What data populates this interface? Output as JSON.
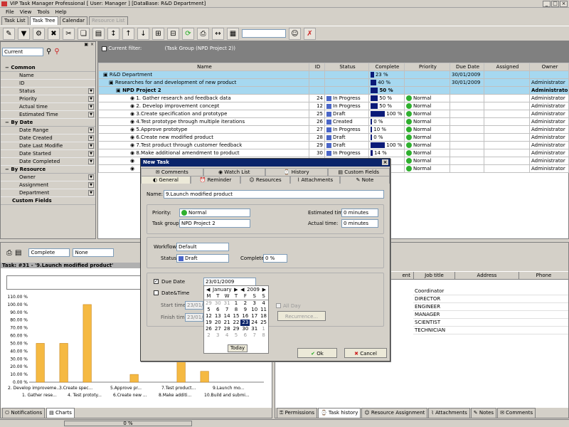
{
  "app": {
    "title": "VIP Task Manager Professional [ User: Manager ] [DataBase: R&D Department]"
  },
  "menu": [
    "File",
    "View",
    "Tools",
    "Help"
  ],
  "top_tabs": [
    {
      "label": "Task List"
    },
    {
      "label": "Task Tree"
    },
    {
      "label": "Calendar"
    },
    {
      "label": "Resource List"
    }
  ],
  "left_panel": {
    "view_select": "Current",
    "groups": [
      {
        "label": "Common",
        "items": [
          "Name",
          "ID",
          "Status",
          "Priority",
          "Actual time",
          "Estimated Time"
        ]
      },
      {
        "label": "By Date",
        "items": [
          "Date Range",
          "Date Created",
          "Date Last Modifie",
          "Date Started",
          "Date Completed"
        ]
      },
      {
        "label": "By Resource",
        "items": [
          "Owner",
          "Assignment",
          "Department"
        ]
      },
      {
        "label": "Custom Fields",
        "items": []
      }
    ]
  },
  "grid": {
    "filter_label": "Current filter:",
    "filter_value": "(Task Group  (NPD Project 2))",
    "columns": [
      "Name",
      "ID",
      "Status",
      "Complete",
      "Priority",
      "Due Date",
      "Assigned",
      "Owner"
    ],
    "rows": [
      {
        "name": "R&D Department",
        "id": "",
        "status": "",
        "complete": "23 %",
        "pct": 23,
        "priority": "",
        "due": "30/01/2009",
        "assigned": "",
        "owner": "",
        "kind": "hl"
      },
      {
        "name": "Researches for and development of new product",
        "id": "",
        "status": "",
        "complete": "40 %",
        "pct": 40,
        "priority": "",
        "due": "30/01/2009",
        "assigned": "",
        "owner": "Administrator",
        "kind": "hl"
      },
      {
        "name": "NPD Project 2",
        "id": "",
        "status": "",
        "complete": "50 %",
        "pct": 50,
        "priority": "",
        "due": "",
        "assigned": "",
        "owner": "Administrator",
        "kind": "hlbold"
      },
      {
        "name": "1. Gather research and feedback data",
        "id": "24",
        "status": "In Progress",
        "complete": "50 %",
        "pct": 50,
        "priority": "Normal",
        "due": "",
        "assigned": "",
        "owner": "Administrator",
        "kind": ""
      },
      {
        "name": "2. Develop improvement concept",
        "id": "12",
        "status": "In Progress",
        "complete": "50 %",
        "pct": 50,
        "priority": "Normal",
        "due": "",
        "assigned": "",
        "owner": "Administrator",
        "kind": ""
      },
      {
        "name": "3.Create specification and prototype",
        "id": "25",
        "status": "Draft",
        "complete": "100 %",
        "pct": 100,
        "priority": "Normal",
        "due": "",
        "assigned": "",
        "owner": "Administrator",
        "kind": ""
      },
      {
        "name": "4.Test prototype through multiple iterations",
        "id": "26",
        "status": "Created",
        "complete": "0 %",
        "pct": 0,
        "priority": "Normal",
        "due": "",
        "assigned": "",
        "owner": "Administrator",
        "kind": ""
      },
      {
        "name": "5.Approve prototype",
        "id": "27",
        "status": "In Progress",
        "complete": "10 %",
        "pct": 10,
        "priority": "Normal",
        "due": "",
        "assigned": "",
        "owner": "Administrator",
        "kind": ""
      },
      {
        "name": "6.Create new modified product",
        "id": "28",
        "status": "Draft",
        "complete": "0 %",
        "pct": 0,
        "priority": "Normal",
        "due": "",
        "assigned": "",
        "owner": "Administrator",
        "kind": ""
      },
      {
        "name": "7.Test product through customer feedback",
        "id": "29",
        "status": "Draft",
        "complete": "100 %",
        "pct": 100,
        "priority": "Normal",
        "due": "",
        "assigned": "",
        "owner": "Administrator",
        "kind": ""
      },
      {
        "name": "8.Make additional amendment to product",
        "id": "30",
        "status": "In Progress",
        "complete": "14 %",
        "pct": 14,
        "priority": "Normal",
        "due": "",
        "assigned": "",
        "owner": "Administrator",
        "kind": ""
      },
      {
        "name": "",
        "id": "",
        "status": "",
        "complete": "",
        "pct": 0,
        "priority": "Normal",
        "due": "",
        "assigned": "",
        "owner": "Administrator",
        "kind": ""
      },
      {
        "name": "",
        "id": "",
        "status": "",
        "complete": "",
        "pct": 0,
        "priority": "Normal",
        "due": "",
        "assigned": "",
        "owner": "Administrator",
        "kind": ""
      }
    ]
  },
  "bottom_left": {
    "sel1": "Complete",
    "sel2": "None",
    "task_header": "Task: #31 - '9.Launch modified product'",
    "tabs": [
      "Notifications",
      "Charts"
    ]
  },
  "chart_data": {
    "type": "bar",
    "categories": [
      "1. Gather rese...",
      "2. Develop improveme...",
      "3.Create spec...",
      "4. Test prototy...",
      "5.Approve pr...",
      "6.Create new ...",
      "7.Test product...",
      "8.Make additi...",
      "9.Launch mo...",
      "10.Build and submi..."
    ],
    "values": [
      50,
      50,
      100,
      0,
      10,
      0,
      100,
      14,
      0,
      0
    ],
    "ylim": [
      0,
      110
    ],
    "yticks": [
      "110.00 %",
      "100.00 %",
      "90.00 %",
      "80.00 %",
      "70.00 %",
      "60.00 %",
      "50.00 %",
      "40.00 %",
      "30.00 %",
      "20.00 %",
      "10.00 %",
      "0.00 %"
    ],
    "xlabels_row1": [
      "2. Develop improveme...",
      "3.Create spec...",
      "5.Approve pr...",
      "7.Test product...",
      "9.Launch mo..."
    ],
    "xlabels_row2": [
      "1. Gather rese...",
      "4. Test prototy...",
      "6.Create new ...",
      "8.Make additi...",
      "10.Build and submi..."
    ],
    "bar_color": "#f5b942"
  },
  "bottom_right": {
    "columns": [
      "ent",
      "Job title",
      "Address",
      "Phone"
    ],
    "jobs": [
      "Coordinator",
      "DIRECTOR",
      "ENGINEER",
      "MANAGER",
      "SCIENTIST",
      "TECHNICIAN"
    ],
    "tabs": [
      "Permissions",
      "Task history",
      "Resource Assignment",
      "Attachments",
      "Notes",
      "Comments"
    ]
  },
  "status_bar": {
    "progress": "0 %"
  },
  "dialog": {
    "title": "New Task",
    "tabs_row1": [
      "Comments",
      "Watch List",
      "History",
      "Custom Fields"
    ],
    "tabs_row2": [
      "General",
      "Reminder",
      "Resources",
      "Attachments",
      "Note"
    ],
    "name_label": "Name:",
    "name_value": "9.Launch modified product",
    "priority_label": "Priority:",
    "priority_value": "Normal",
    "taskgroup_label": "Task group:",
    "taskgroup_value": "NPD Project 2",
    "est_label": "Estimated time:",
    "est_value": "0 minutes",
    "actual_label": "Actual time:",
    "actual_value": "0 minutes",
    "workflow_label": "Workflow:",
    "workflow_value": "Default",
    "status_label": "Status:",
    "status_value": "Draft",
    "complete_label": "Complete:",
    "complete_value": "0 %",
    "duedate_label": "Due Date",
    "duedate_value": "23/01/2009",
    "datetime_label": "Date&Time",
    "start_label": "Start time:",
    "start_value": "23/01/",
    "finish_label": "Finish time:",
    "finish_value": "23/01/",
    "allday_label": "All Day",
    "recurrence_label": "Recurrence...",
    "ok_label": "Ok",
    "cancel_label": "Cancel",
    "calendar": {
      "month": "January",
      "year": "2009",
      "weekdays": [
        "M",
        "T",
        "W",
        "T",
        "F",
        "S",
        "S"
      ],
      "days": [
        "29",
        "30",
        "31",
        "1",
        "2",
        "3",
        "4",
        "5",
        "6",
        "7",
        "8",
        "9",
        "10",
        "11",
        "12",
        "13",
        "14",
        "15",
        "16",
        "17",
        "18",
        "19",
        "20",
        "21",
        "22",
        "23",
        "24",
        "25",
        "26",
        "27",
        "28",
        "29",
        "30",
        "31",
        "1",
        "2",
        "3",
        "4",
        "5",
        "6",
        "7",
        "8"
      ],
      "today_label": "Today"
    }
  }
}
